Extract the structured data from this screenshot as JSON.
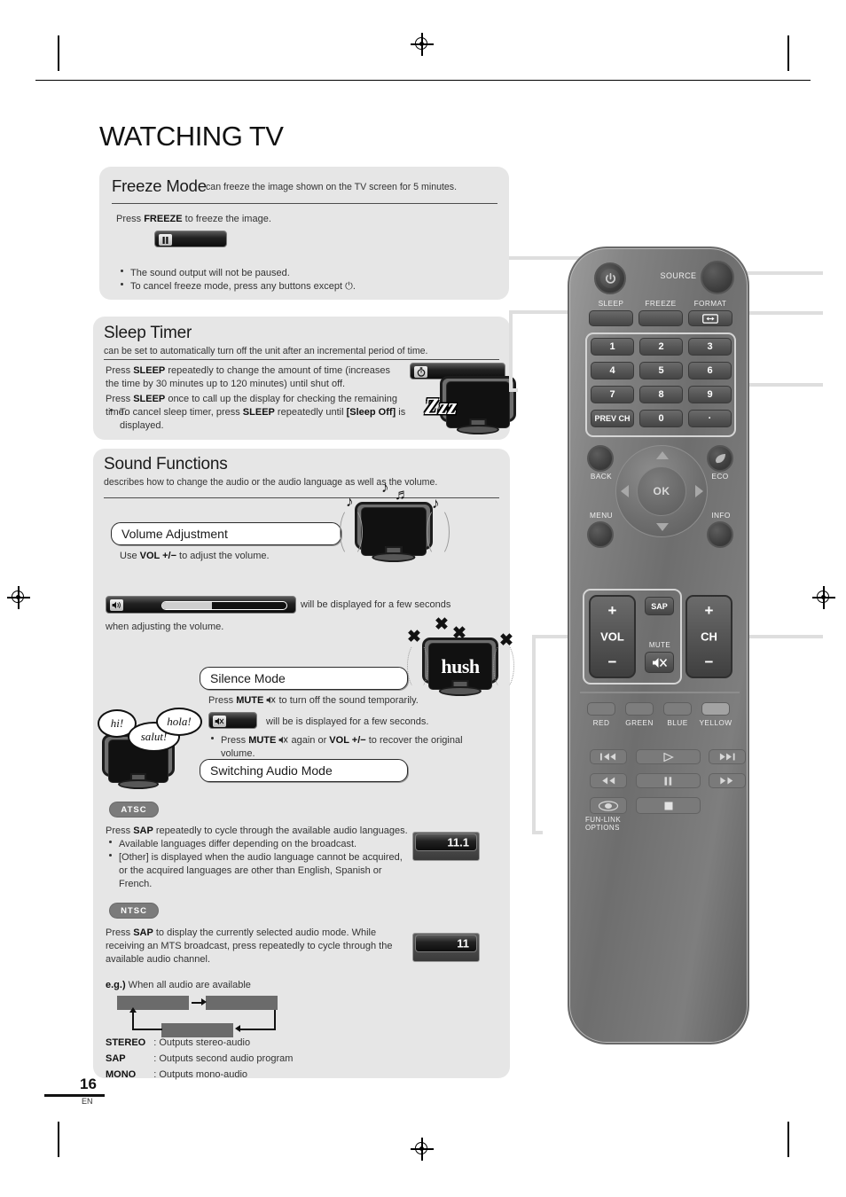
{
  "page": {
    "title": "WATCHING TV",
    "number": "16",
    "lang": "EN"
  },
  "freeze": {
    "heading": "Freeze Mode",
    "subheading": "can freeze the image shown on the TV screen for 5 minutes.",
    "instruction_pre": "Press ",
    "instruction_key": "FREEZE",
    "instruction_post": " to freeze the image.",
    "osd_icon": "pause-icon",
    "bullets": [
      "The sound output will not be paused.",
      "To cancel freeze mode, press any buttons except ⏻."
    ]
  },
  "sleep": {
    "heading": "Sleep Timer",
    "subheading": "can be set to automatically turn off the unit after an incremental period of time.",
    "para1_pre": "Press ",
    "para1_key": "SLEEP",
    "para1_post": " repeatedly to change the amount of time (increases the time by 30 minutes up to 120 minutes) until shut off.",
    "para2_pre": "Press ",
    "para2_key": "SLEEP",
    "para2_post": " once to call up the display for checking the remaining time.",
    "bullet_parts": [
      "To cancel sleep timer, press ",
      "SLEEP",
      " repeatedly until ",
      "[Sleep Off]",
      " is displayed."
    ],
    "osd_icon": "timer-icon",
    "tv_text": "Zzz"
  },
  "sound": {
    "heading": "Sound Functions",
    "subheading": "describes how to change the audio or the audio language as well as the volume.",
    "volume": {
      "label": "Volume Adjustment",
      "text_pre": "Use ",
      "text_key": "VOL +/−",
      "text_post": " to adjust the volume.",
      "osd_icon": "volume-icon",
      "osd_fill_percent": 40,
      "caption_a": "will be displayed for a few seconds",
      "caption_b": "when adjusting the volume."
    },
    "silence": {
      "label": "Silence Mode",
      "line1_pre": "Press ",
      "line1_key": "MUTE",
      "line1_post": " to turn off the sound temporarily.",
      "osd_icon": "mute-icon",
      "line2": "will be is displayed for a few seconds.",
      "bullet_pre": "Press ",
      "bullet_key1": "MUTE",
      "bullet_mid": " again or ",
      "bullet_key2": "VOL +/−",
      "bullet_post": " to recover the original volume.",
      "tv_text": "hush"
    },
    "switching": {
      "label": "Switching Audio Mode",
      "bubbles": [
        "hi!",
        "salut!",
        "hola!"
      ],
      "atsc": {
        "badge": "ATSC",
        "line_pre": "Press ",
        "line_key": "SAP",
        "line_post": " repeatedly to cycle through the available audio languages.",
        "bullets": [
          "Available languages differ depending on the broadcast.",
          "[Other] is displayed when the audio language cannot be acquired, or the acquired languages are other than English, Spanish or French."
        ],
        "osd_value": "11.1"
      },
      "ntsc": {
        "badge": "NTSC",
        "line1_pre": "Press ",
        "line1_key": "SAP",
        "line1_post": " to display the currently selected audio mode. While receiving an MTS broadcast, press repeatedly to cycle through the available audio channel.",
        "osd_value": "11",
        "eg_label": "e.g.)",
        "eg_text": " When all audio are available",
        "legend": [
          {
            "term": "STEREO",
            "desc": ": Outputs stereo-audio"
          },
          {
            "term": "SAP",
            "desc": ": Outputs second audio program"
          },
          {
            "term": "MONO",
            "desc": ": Outputs mono-audio"
          }
        ]
      }
    }
  },
  "remote": {
    "power_icon": "power-icon",
    "source_label": "SOURCE",
    "source_icon": "source-dial-icon",
    "sleep_label": "SLEEP",
    "freeze_label": "FREEZE",
    "format_label": "FORMAT",
    "format_icon": "format-arrows-icon",
    "keypad": [
      "1",
      "2",
      "3",
      "4",
      "5",
      "6",
      "7",
      "8",
      "9",
      "PREV CH",
      "0",
      "·"
    ],
    "back_label": "BACK",
    "eco_label": "ECO",
    "eco_icon": "leaf-icon",
    "menu_label": "MENU",
    "info_label": "INFO",
    "ok_label": "OK",
    "nav_icons": [
      "arrow-up-icon",
      "arrow-right-icon",
      "arrow-down-icon",
      "arrow-left-icon"
    ],
    "vol_label": "VOL",
    "vol_plus": "+",
    "vol_minus": "−",
    "ch_label": "CH",
    "ch_plus": "+",
    "ch_minus": "−",
    "sap_label": "SAP",
    "mute_label": "MUTE",
    "mute_icon": "mute-speaker-icon",
    "color_buttons": [
      "RED",
      "GREEN",
      "BLUE",
      "YELLOW"
    ],
    "media_icons": [
      "skip-back-icon",
      "play-icon",
      "skip-forward-icon",
      "rewind-icon",
      "pause-icon",
      "fast-forward-icon",
      "funlink-icon",
      "stop-icon"
    ],
    "funlink_label_1": "FUN-LINK",
    "funlink_label_2": "OPTIONS"
  }
}
